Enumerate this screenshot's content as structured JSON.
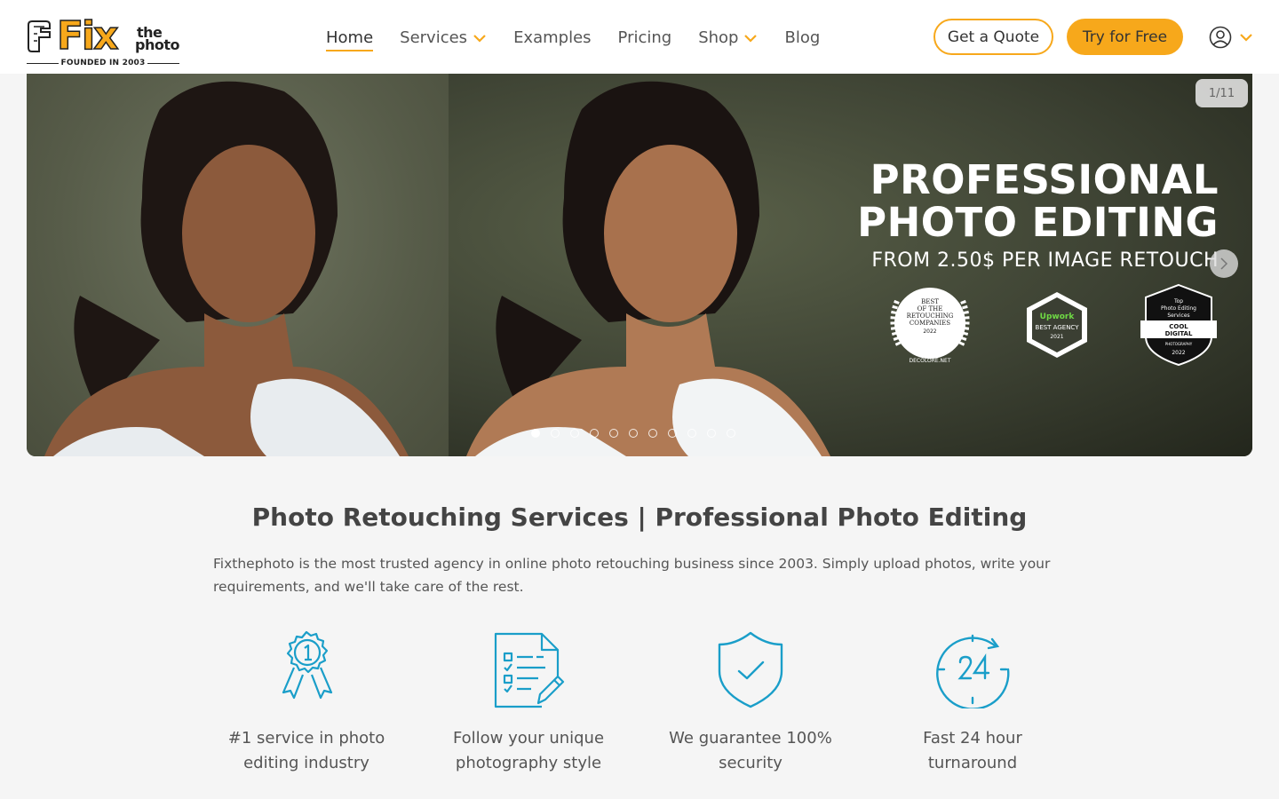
{
  "brand": {
    "logo_main": "Fix",
    "logo_the": "the",
    "logo_photo": "photo",
    "logo_founded": "FOUNDED IN 2003",
    "accent_color": "#f7a81b"
  },
  "nav": {
    "items": [
      {
        "label": "Home",
        "active": true,
        "has_dropdown": false
      },
      {
        "label": "Services",
        "active": false,
        "has_dropdown": true
      },
      {
        "label": "Examples",
        "active": false,
        "has_dropdown": false
      },
      {
        "label": "Pricing",
        "active": false,
        "has_dropdown": false
      },
      {
        "label": "Shop",
        "active": false,
        "has_dropdown": true
      },
      {
        "label": "Blog",
        "active": false,
        "has_dropdown": false
      }
    ]
  },
  "header_actions": {
    "quote_label": "Get a Quote",
    "try_label": "Try for Free",
    "user_icon": "user-circle-icon"
  },
  "hero": {
    "counter": "1/11",
    "title_line1": "PROFESSIONAL",
    "title_line2": "PHOTO EDITING",
    "subtitle": "FROM 2.50$ PER IMAGE RETOUCH",
    "badges": [
      {
        "lines": [
          "BEST",
          "OF THE",
          "RETOUCHING",
          "COMPANIES",
          "2022"
        ],
        "footer": "DECOLORE.NET"
      },
      {
        "lines": [
          "Upwork",
          "BEST AGENCY",
          "2021"
        ]
      },
      {
        "lines": [
          "Top",
          "Photo Editing",
          "Services",
          "COOL",
          "DIGITAL",
          "PHOTOGRAPHY",
          "2022"
        ]
      }
    ],
    "slide_count": 11,
    "active_slide": 1
  },
  "main": {
    "title": "Photo Retouching Services | Professional Photo Editing",
    "intro": "Fixthephoto is the most trusted agency in online photo retouching business since 2003. Simply upload photos, write your requirements, and we'll take care of the rest.",
    "features": [
      {
        "icon": "award-ribbon-icon",
        "text_line1": "#1 service in photo",
        "text_line2": "editing industry"
      },
      {
        "icon": "checklist-pencil-icon",
        "text_line1": "Follow your unique",
        "text_line2": "photography style"
      },
      {
        "icon": "shield-check-icon",
        "text_line1": "We guarantee 100%",
        "text_line2": "security"
      },
      {
        "icon": "clock-24-icon",
        "text_line1": "Fast 24 hour",
        "text_line2": "turnaround"
      }
    ],
    "icon_color": "#1a9ec9"
  }
}
